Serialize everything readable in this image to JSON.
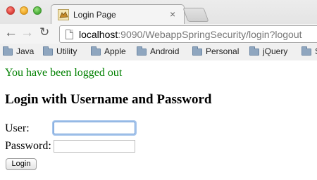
{
  "browser": {
    "tab": {
      "title": "Login Page",
      "close_glyph": "×"
    },
    "nav": {
      "back_glyph": "←",
      "forward_glyph": "→",
      "reload_glyph": "↻"
    },
    "address_bar": {
      "host": "localhost",
      "rest": ":9090/WebappSpringSecurity/login?logout"
    },
    "bookmarks": [
      {
        "label": "Java"
      },
      {
        "label": "Utility"
      },
      {
        "label": "Apple"
      },
      {
        "label": "Android"
      },
      {
        "label": "Personal"
      },
      {
        "label": "jQuery"
      },
      {
        "label": "S"
      }
    ]
  },
  "page": {
    "message": "You have been logged out",
    "heading": "Login with Username and Password",
    "form": {
      "user_label": "User:",
      "user_value": "",
      "password_label": "Password:",
      "password_value": "",
      "submit_label": "Login"
    }
  },
  "colors": {
    "message_green": "#008000",
    "focus_ring": "#a8c6ec"
  }
}
